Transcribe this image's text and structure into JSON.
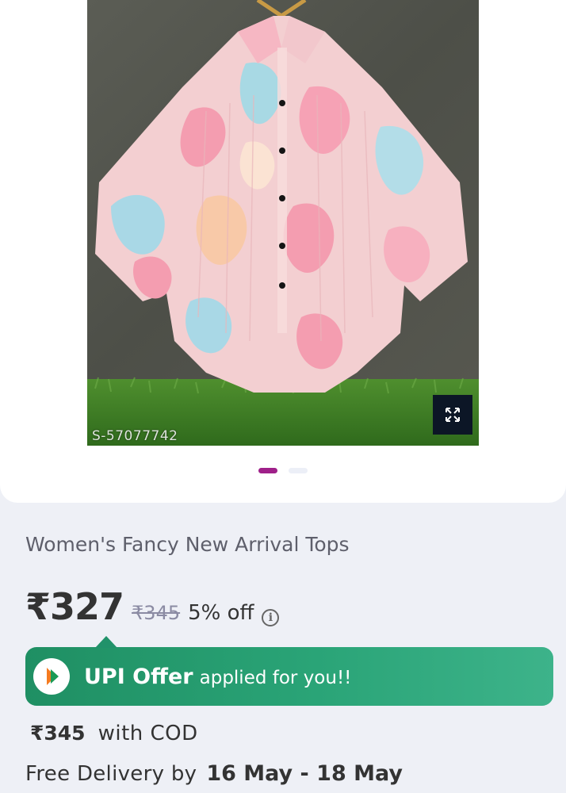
{
  "product": {
    "image_sku": "S-57077742",
    "image_alt": "pastel tie-dye shirt on hanger",
    "carousel": {
      "total": 2,
      "active_index": 0
    },
    "title": "Women's Fancy New Arrival Tops"
  },
  "price": {
    "current": "₹327",
    "mrp": "₹345",
    "discount": "5% off",
    "info_icon": "i"
  },
  "upi_offer": {
    "strong": "UPI Offer",
    "rest": "applied for you!!",
    "icon": "upi-logo-icon"
  },
  "cod": {
    "price": "₹345",
    "label": "with COD"
  },
  "delivery": {
    "label": "Free Delivery by",
    "date": "16 May - 18 May"
  },
  "colors": {
    "accent": "#9f2089",
    "upi_green": "#2aa477",
    "text_dark": "#333333",
    "text_muted": "#5e5f6b",
    "mrp_grey": "#8b8ba3"
  }
}
